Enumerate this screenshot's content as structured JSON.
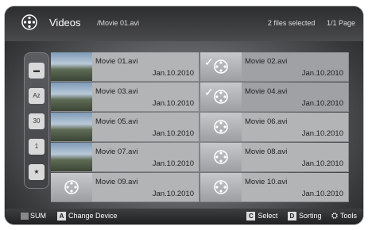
{
  "header": {
    "title": "Videos",
    "path": "/Movie 01.avi",
    "selection": "2 files selected",
    "page": "1/1 Page"
  },
  "sidebar": {
    "items": [
      {
        "icon": "folder-icon",
        "label": ""
      },
      {
        "icon": "sort-az-icon",
        "label": "Az"
      },
      {
        "icon": "calendar-icon",
        "label": "30"
      },
      {
        "icon": "calendar-1-icon",
        "label": "1"
      },
      {
        "icon": "star-icon",
        "label": "★"
      }
    ]
  },
  "files": [
    {
      "name": "Movie 01.avi",
      "date": "Jan.10.2010",
      "thumb": "photo",
      "selected": false
    },
    {
      "name": "Movie 02.avi",
      "date": "Jan.10.2010",
      "thumb": "reel",
      "selected": true
    },
    {
      "name": "Movie 03.avi",
      "date": "Jan.10.2010",
      "thumb": "photo",
      "selected": false
    },
    {
      "name": "Movie 04.avi",
      "date": "Jan.10.2010",
      "thumb": "reel",
      "selected": true
    },
    {
      "name": "Movie 05.avi",
      "date": "Jan.10.2010",
      "thumb": "photo",
      "selected": false
    },
    {
      "name": "Movie 06.avi",
      "date": "Jan.10.2010",
      "thumb": "reel",
      "selected": false
    },
    {
      "name": "Movie 07.avi",
      "date": "Jan.10.2010",
      "thumb": "photo",
      "selected": false
    },
    {
      "name": "Movie 08.avi",
      "date": "Jan.10.2010",
      "thumb": "reel",
      "selected": false
    },
    {
      "name": "Movie 09.avi",
      "date": "Jan.10.2010",
      "thumb": "reel",
      "selected": false
    },
    {
      "name": "Movie 10.avi",
      "date": "Jan.10.2010",
      "thumb": "reel",
      "selected": false
    }
  ],
  "footer": {
    "sum": "SUM",
    "change_key": "A",
    "change_label": "Change Device",
    "select_key": "C",
    "select_label": "Select",
    "sort_key": "D",
    "sort_label": "Sorting",
    "tools_label": "Tools"
  },
  "colors": {
    "header_bg": "#3a3b3d",
    "cell_bg": "#b3b4b6",
    "footer_bg": "#202122"
  }
}
